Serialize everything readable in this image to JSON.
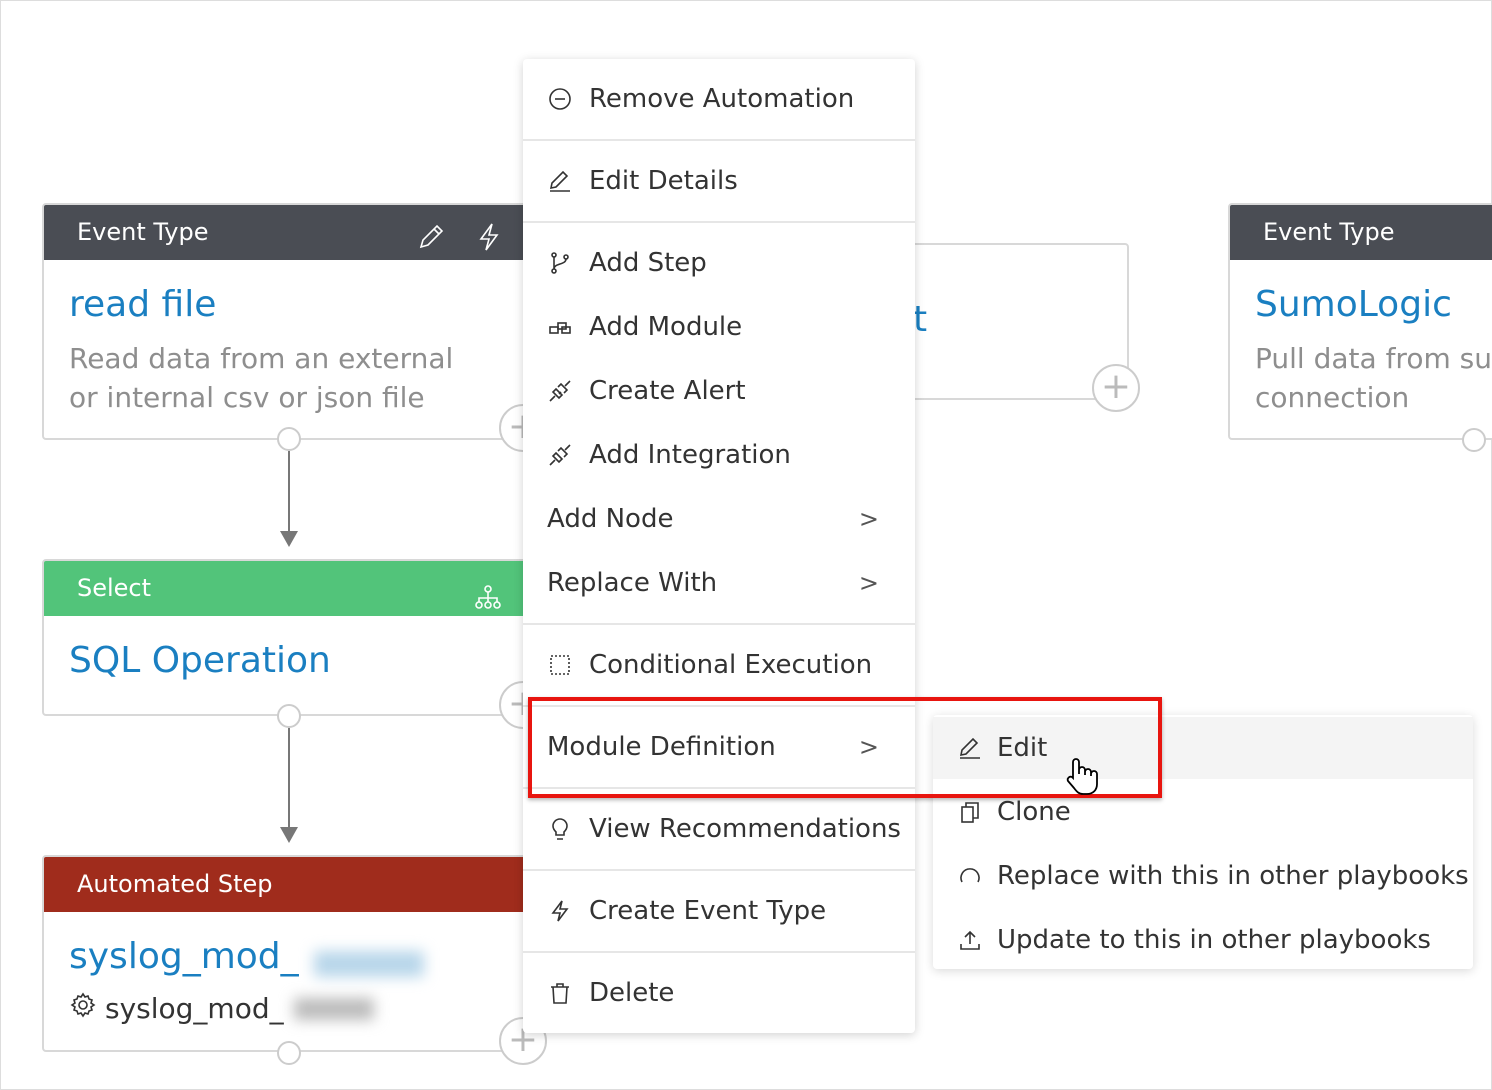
{
  "nodes": [
    {
      "header": "Event Type",
      "header_color": "#4a4d54",
      "title": "read file",
      "description": "Read data from an external or internal csv or json file"
    },
    {
      "header": "Select",
      "header_color": "#52c47a",
      "title": "SQL Operation"
    },
    {
      "header": "Automated Step",
      "header_color": "#a02c1c",
      "title": "syslog_mod_",
      "subtitle": "syslog_mod_"
    },
    {
      "title_fragment": "t"
    },
    {
      "header": "Event Type",
      "header_color": "#4a4d54",
      "title": "SumoLogic",
      "description": "Pull data from su connection"
    }
  ],
  "context_menu": {
    "items": [
      {
        "label": "Remove Automation",
        "icon": "minus-circle-icon"
      },
      {
        "label": "Edit Details",
        "icon": "pencil-icon"
      },
      {
        "label": "Add Step",
        "icon": "branch-icon"
      },
      {
        "label": "Add Module",
        "icon": "module-icon"
      },
      {
        "label": "Create Alert",
        "icon": "plug-icon"
      },
      {
        "label": "Add Integration",
        "icon": "plug-icon"
      },
      {
        "label": "Add Node",
        "has_submenu": true
      },
      {
        "label": "Replace With",
        "has_submenu": true
      },
      {
        "label": "Conditional Execution",
        "icon": "dashed-box-icon"
      },
      {
        "label": "Module Definition",
        "has_submenu": true,
        "highlighted": true
      },
      {
        "label": "View Recommendations",
        "icon": "lightbulb-icon"
      },
      {
        "label": "Create Event Type",
        "icon": "bolt-icon"
      },
      {
        "label": "Delete",
        "icon": "trash-icon"
      }
    ]
  },
  "submenu": {
    "items": [
      {
        "label": "Edit",
        "icon": "pencil-icon",
        "hovered": true
      },
      {
        "label": "Clone",
        "icon": "copy-icon"
      },
      {
        "label": "Replace with this in other playbooks",
        "icon": "refresh-icon"
      },
      {
        "label": "Update to this in other playbooks",
        "icon": "upload-icon"
      }
    ]
  },
  "highlight_color": "#e8150f"
}
